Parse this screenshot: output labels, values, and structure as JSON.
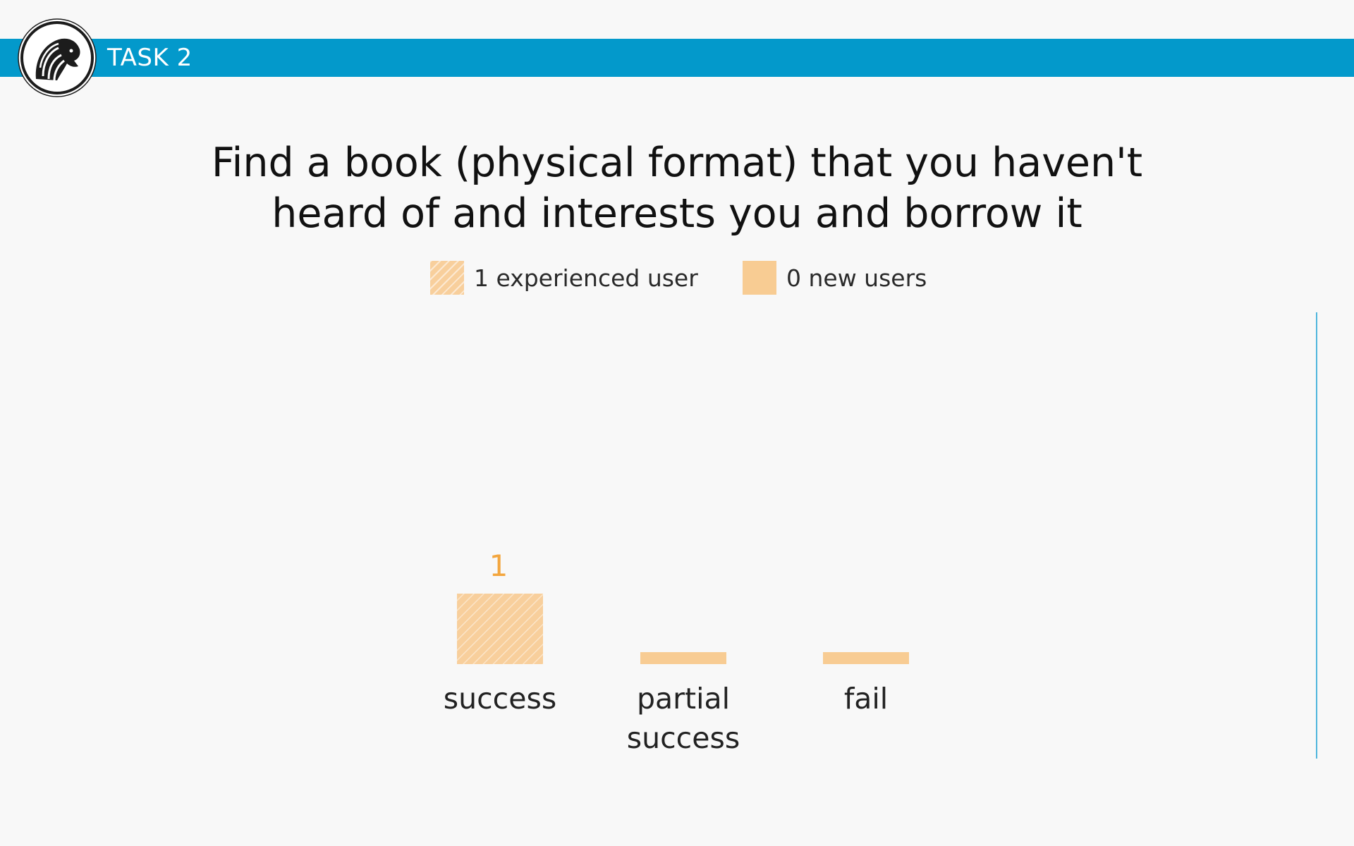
{
  "header": {
    "label": "TASK 2",
    "logo_icon": "lion-logo-icon"
  },
  "colors": {
    "header_bar": "#0399cb",
    "bar_fill": "#f8cc93",
    "data_label": "#f3a63e",
    "right_rule": "#4fb6dd"
  },
  "chart_data": {
    "type": "bar",
    "title": "Find a book (physical format) that you haven't heard of and interests you and borrow it",
    "title_lines": [
      "Find a book (physical format) that you haven't",
      "heard of and interests you and borrow it"
    ],
    "categories": [
      "success",
      "partial success"
    ],
    "category_lines": [
      [
        "success"
      ],
      [
        "partial",
        "success"
      ],
      [
        "fail"
      ]
    ],
    "series": [
      {
        "name": "1 experienced user",
        "values": [
          1,
          0,
          0
        ],
        "pattern": "hatched"
      },
      {
        "name": "0 new users",
        "values": [
          0,
          0,
          0
        ],
        "pattern": "solid"
      }
    ],
    "data_labels": [
      "1",
      "",
      ""
    ],
    "ylim": [
      0,
      6
    ],
    "xlabel": "",
    "ylabel": "",
    "grid": false,
    "legend_position": "top-center"
  }
}
